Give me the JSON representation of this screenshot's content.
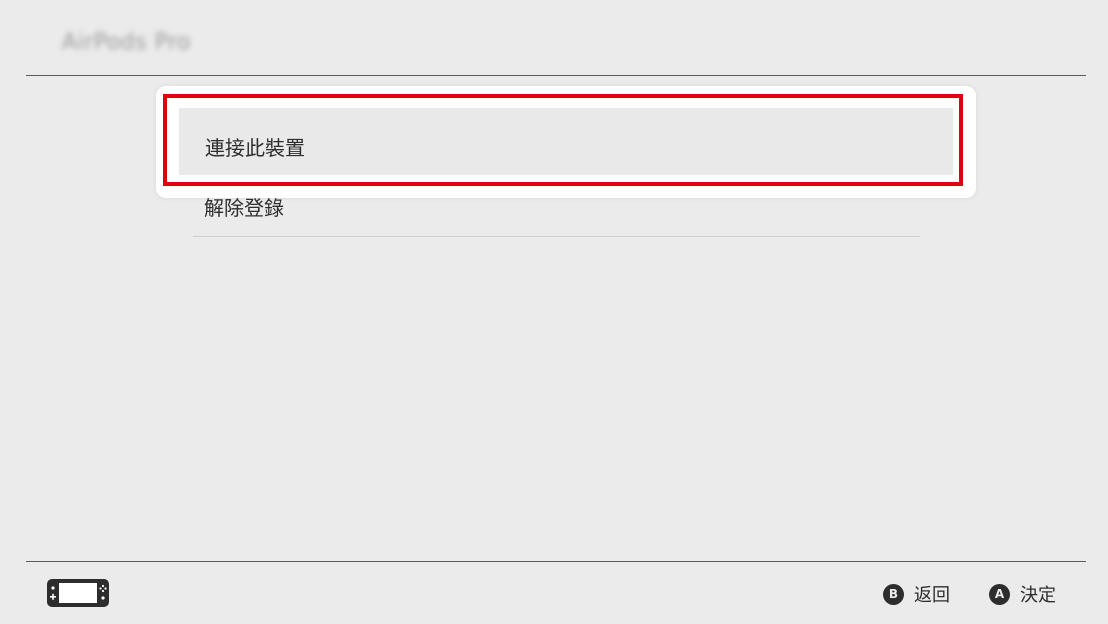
{
  "header": {
    "title": "AirPods Pro"
  },
  "menu": {
    "items": [
      {
        "label": "連接此裝置",
        "focused": true
      },
      {
        "label": "解除登錄",
        "focused": false
      }
    ],
    "highlight_color": "#e0000f"
  },
  "footer": {
    "console_icon": "handheld-console-icon",
    "actions": [
      {
        "button": "B",
        "label": "返回"
      },
      {
        "button": "A",
        "label": "決定"
      }
    ]
  }
}
